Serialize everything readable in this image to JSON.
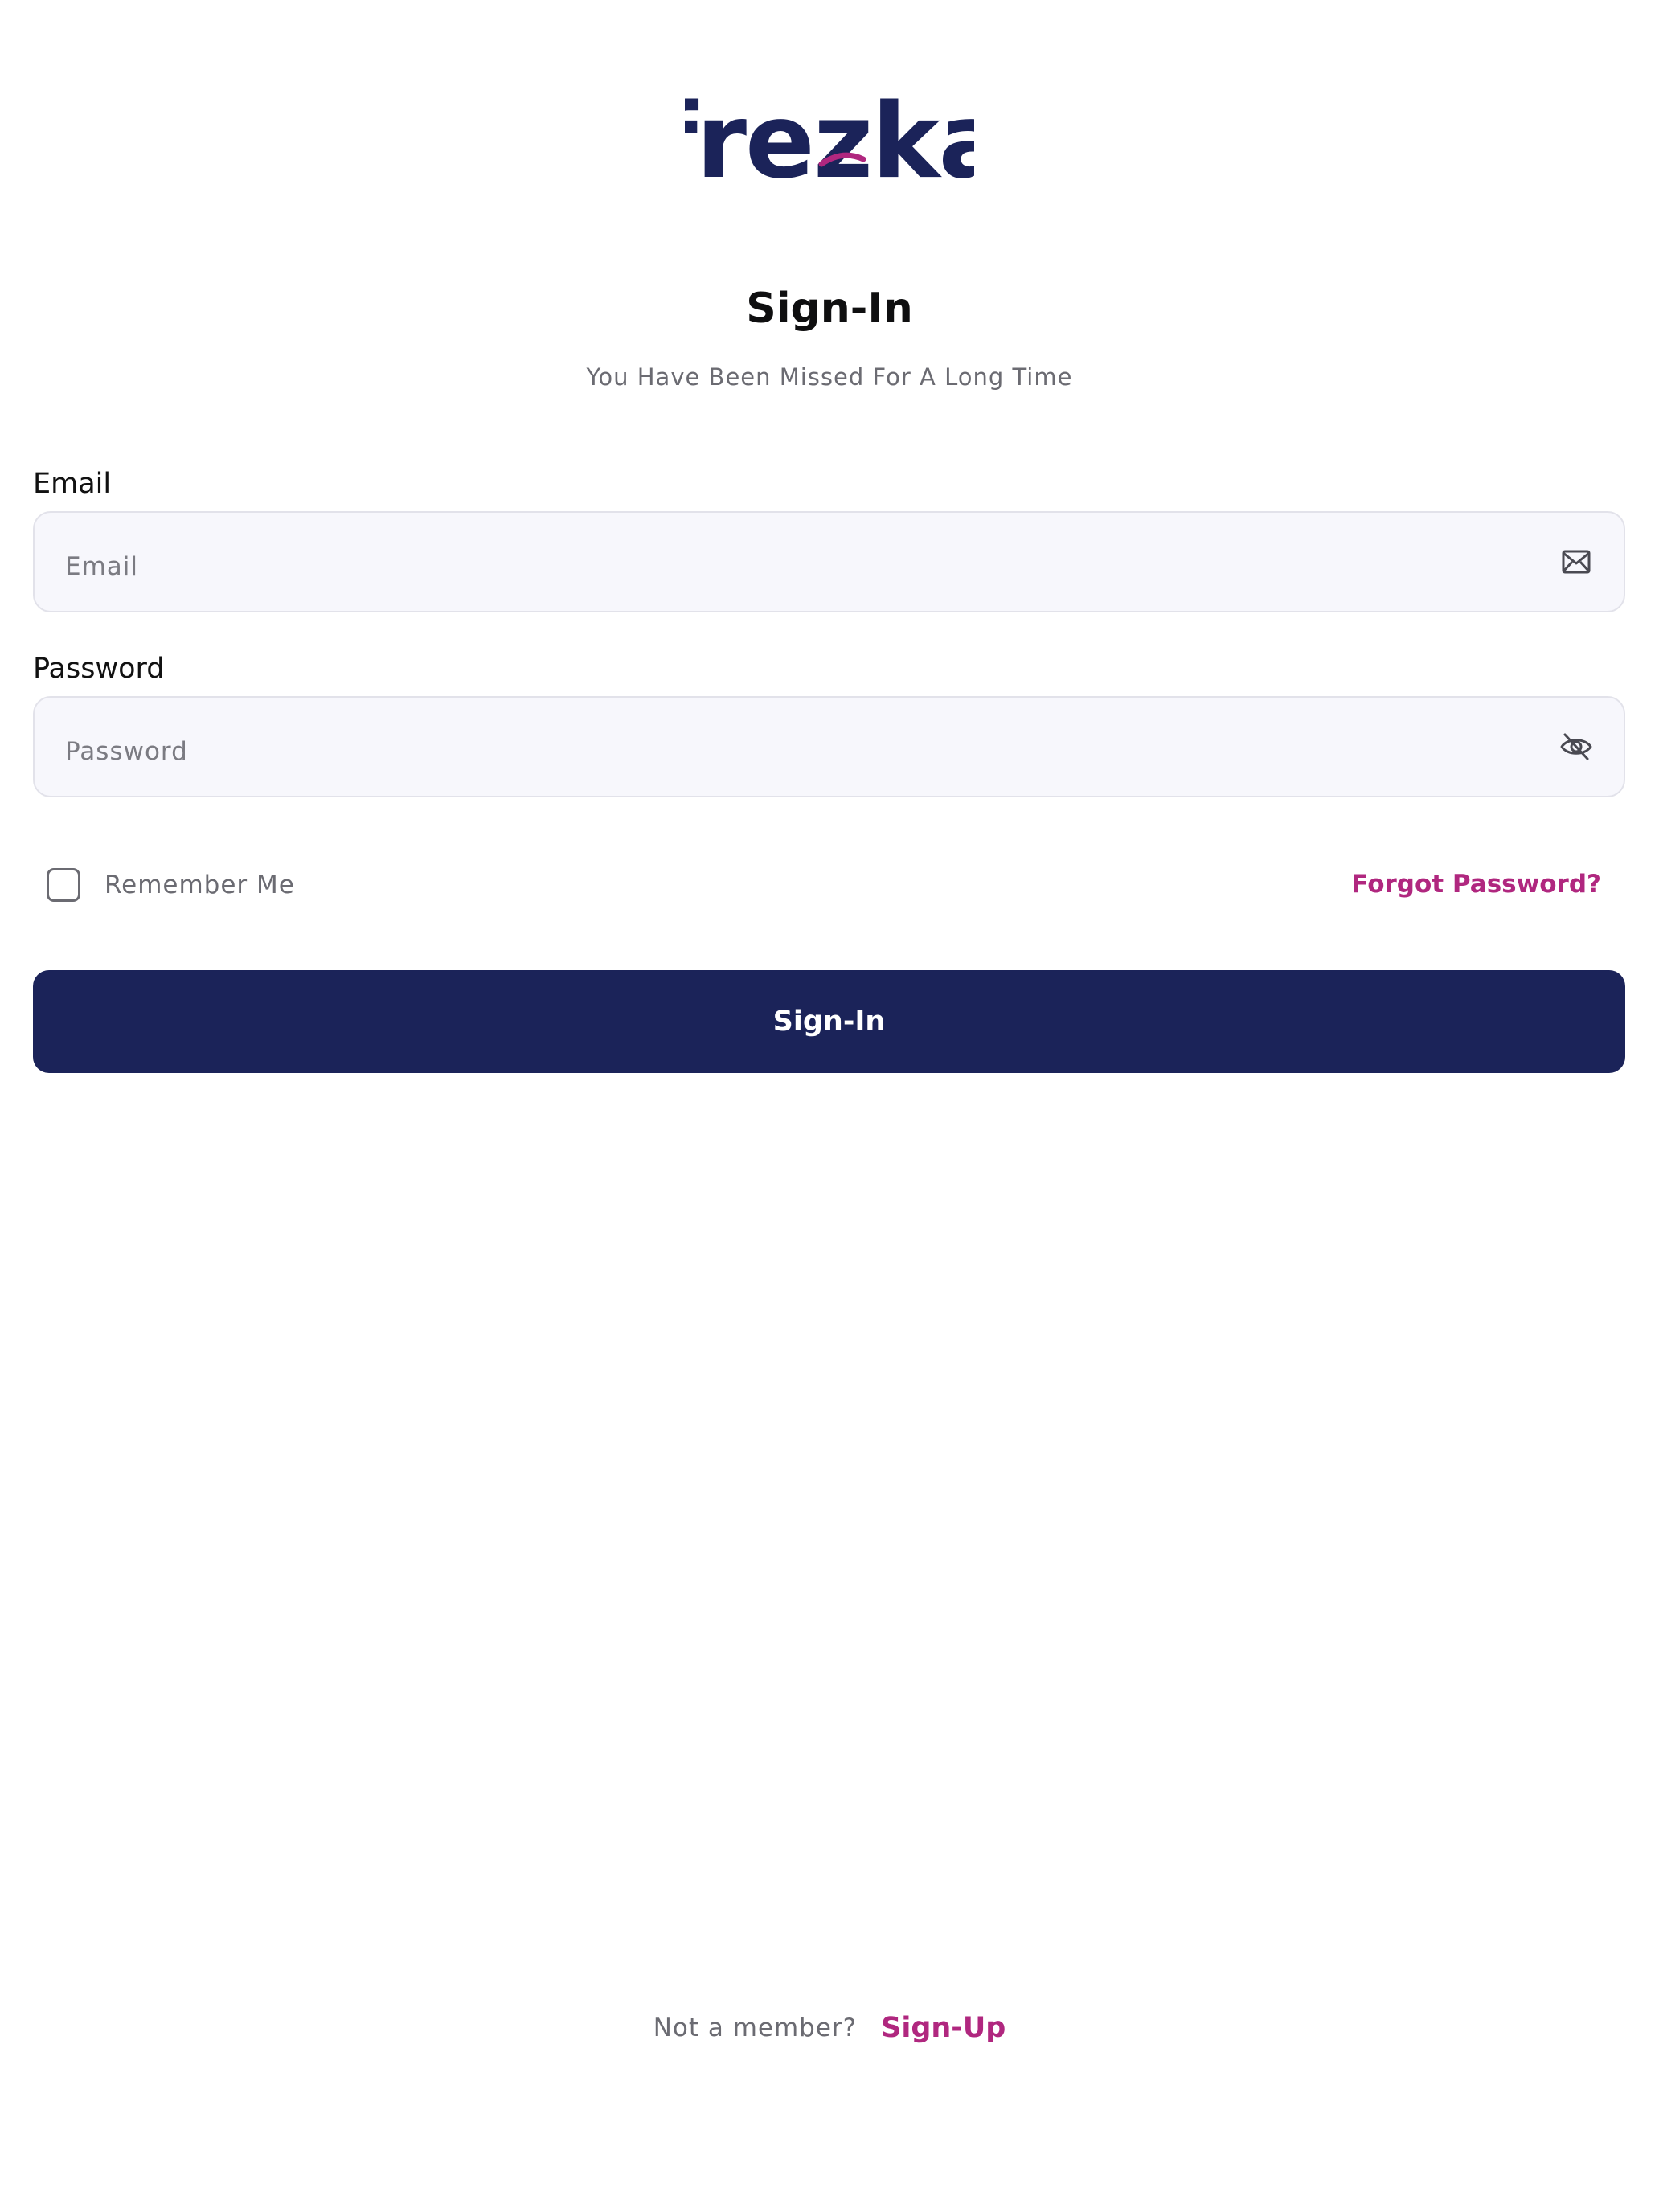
{
  "brand": {
    "logo_text": "frezka",
    "primary_color": "#1b2359",
    "accent_color": "#b0277f"
  },
  "header": {
    "title": "Sign-In",
    "subtitle": "You Have Been Missed For A Long Time"
  },
  "form": {
    "email": {
      "label": "Email",
      "placeholder": "Email",
      "value": "",
      "icon": "mail-icon"
    },
    "password": {
      "label": "Password",
      "placeholder": "Password",
      "value": "",
      "icon": "eye-off-icon"
    },
    "remember_me": {
      "label": "Remember Me",
      "checked": false
    },
    "forgot_password_label": "Forgot Password?",
    "submit_label": "Sign-In"
  },
  "footer": {
    "prompt": "Not a member?",
    "signup_label": "Sign-Up"
  }
}
